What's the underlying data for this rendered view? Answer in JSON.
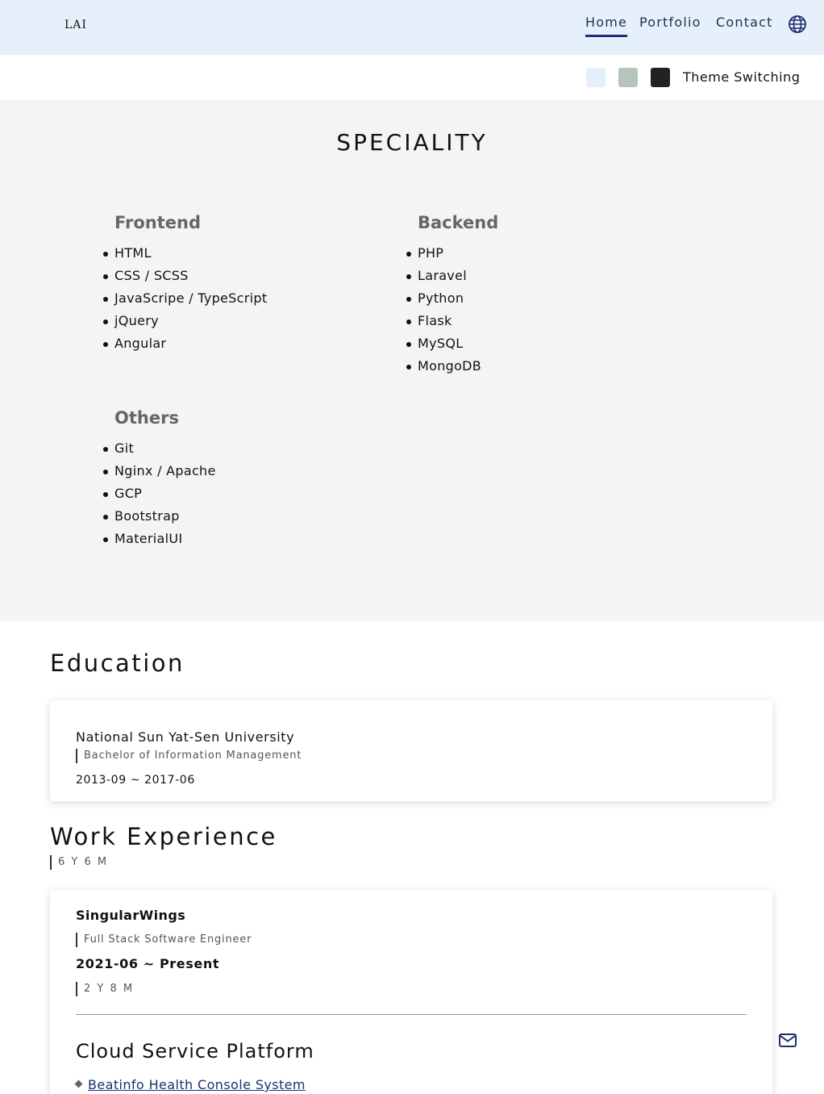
{
  "header": {
    "logo": "LAI",
    "nav": [
      {
        "label": "Home",
        "active": true
      },
      {
        "label": "Portfolio",
        "active": false
      },
      {
        "label": "Contact",
        "active": false
      }
    ],
    "globe_icon": "globe-icon"
  },
  "theme": {
    "label": "Theme Switching",
    "swatches": [
      "#e3f0fc",
      "#b7c4bc",
      "#222222"
    ]
  },
  "speciality": {
    "title": "SPECIALITY",
    "frontend": {
      "heading": "Frontend",
      "items": [
        "HTML",
        "CSS / SCSS",
        "JavaScripe / TypeScript",
        "jQuery",
        "Angular"
      ]
    },
    "backend": {
      "heading": "Backend",
      "items": [
        "PHP",
        "Laravel",
        "Python",
        "Flask",
        "MySQL",
        "MongoDB"
      ]
    },
    "others": {
      "heading": "Others",
      "items": [
        "Git",
        "Nginx / Apache",
        "GCP",
        "Bootstrap",
        "MaterialUI"
      ]
    }
  },
  "education": {
    "title": "Education",
    "school": "National Sun Yat-Sen University",
    "degree": "Bachelor of Information Management",
    "dates": "2013-09 ~ 2017-06"
  },
  "work": {
    "title": "Work Experience",
    "total": "6 Y 6 M",
    "jobs": [
      {
        "company": "SingularWings",
        "title": "Full Stack Software Engineer",
        "dates": "2021-06 ~ Present",
        "duration": "2 Y 8 M",
        "project_title": "Cloud Service Platform",
        "project_link": "Beatinfo Health Console System"
      }
    ]
  },
  "fab": {
    "icon": "mail-icon"
  }
}
